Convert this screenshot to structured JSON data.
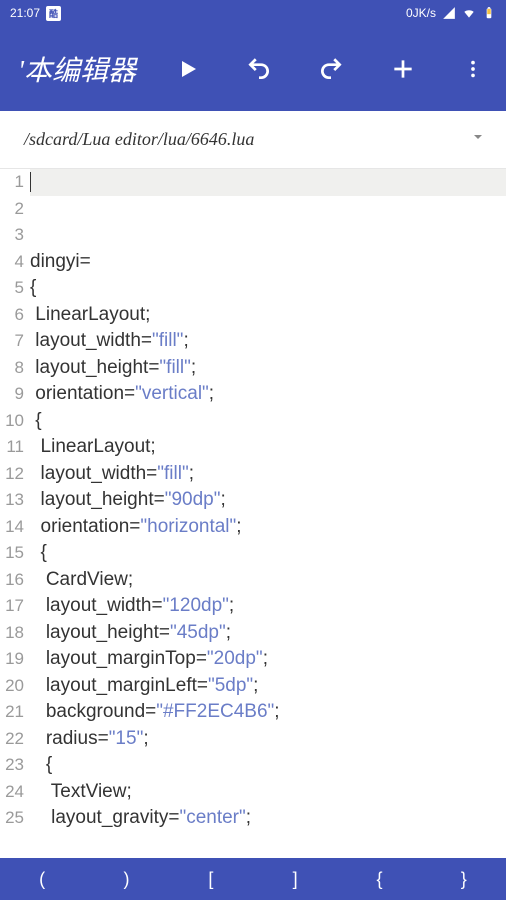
{
  "status": {
    "time": "21:07",
    "speed": "0JK/s"
  },
  "toolbar": {
    "title": "'本编辑器"
  },
  "file": {
    "path": "/sdcard/Lua editor/lua/6646.lua"
  },
  "code": {
    "lines": [
      "",
      "",
      "",
      "dingyi=",
      "{",
      " LinearLayout;",
      " layout_width=\"fill\";",
      " layout_height=\"fill\";",
      " orientation=\"vertical\";",
      " {",
      "  LinearLayout;",
      "  layout_width=\"fill\";",
      "  layout_height=\"90dp\";",
      "  orientation=\"horizontal\";",
      "  {",
      "   CardView;",
      "   layout_width=\"120dp\";",
      "   layout_height=\"45dp\";",
      "   layout_marginTop=\"20dp\";",
      "   layout_marginLeft=\"5dp\";",
      "   background=\"#FF2EC4B6\";",
      "   radius=\"15\";",
      "   {",
      "    TextView;",
      "    layout_gravity=\"center\";"
    ]
  },
  "symbols": [
    "(",
    ")",
    "[",
    "]",
    "{",
    "}"
  ]
}
